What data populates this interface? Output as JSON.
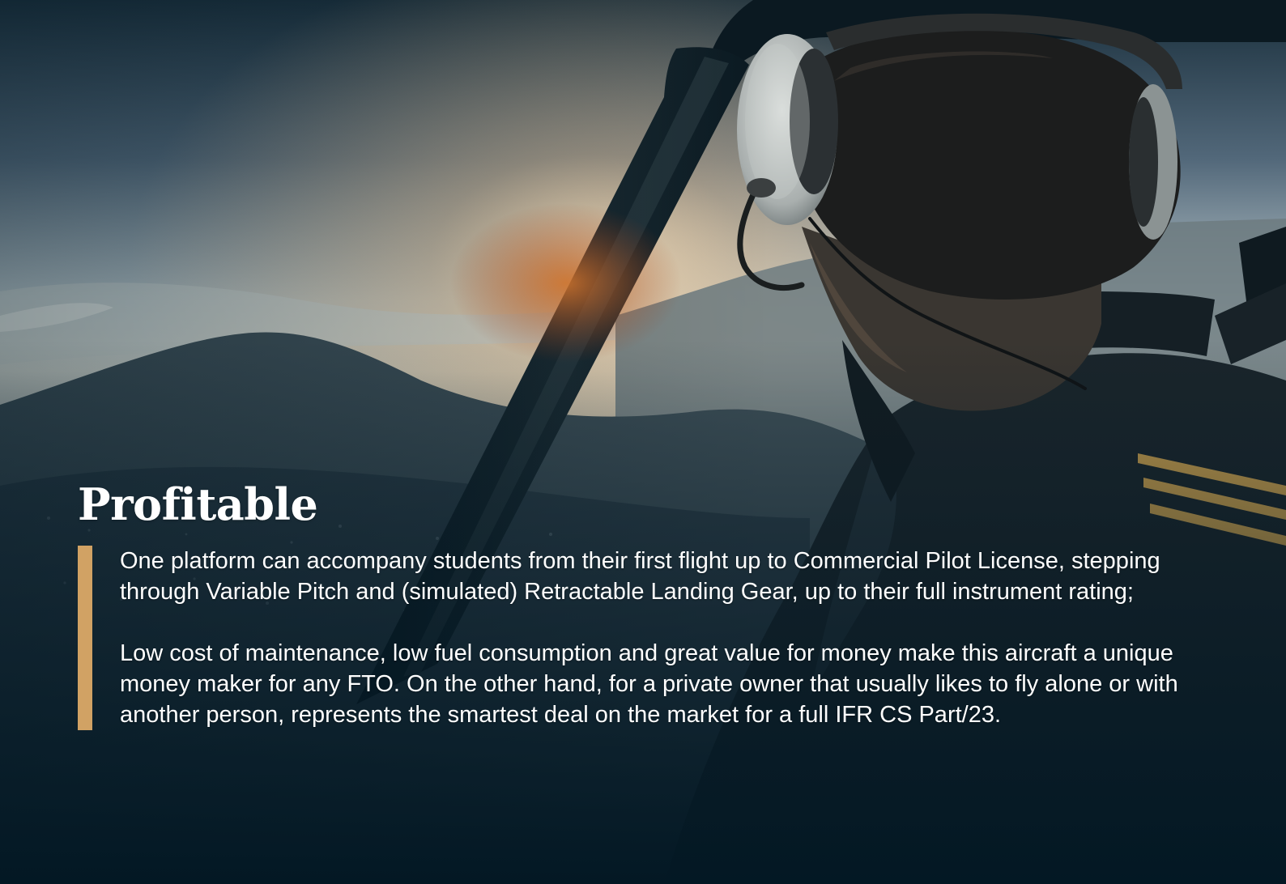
{
  "section": {
    "title": "Profitable",
    "paragraphs": [
      "One platform can accompany students from their first flight up to Commercial Pilot License, stepping through Variable Pitch and (simulated) Retractable Landing Gear, up to their full instrument rating;",
      "Low cost of maintenance, low fuel consumption and great value for money make this aircraft a unique money maker for any FTO. On the other hand, for a private owner that usually likes to fly alone or with another person, represents the smartest deal on the market for a full IFR CS Part/23."
    ]
  },
  "colors": {
    "accent": "#d1a264",
    "background": "#031824",
    "text": "#ffffff"
  },
  "background_image": {
    "icon": "pilot-cockpit-photo"
  }
}
